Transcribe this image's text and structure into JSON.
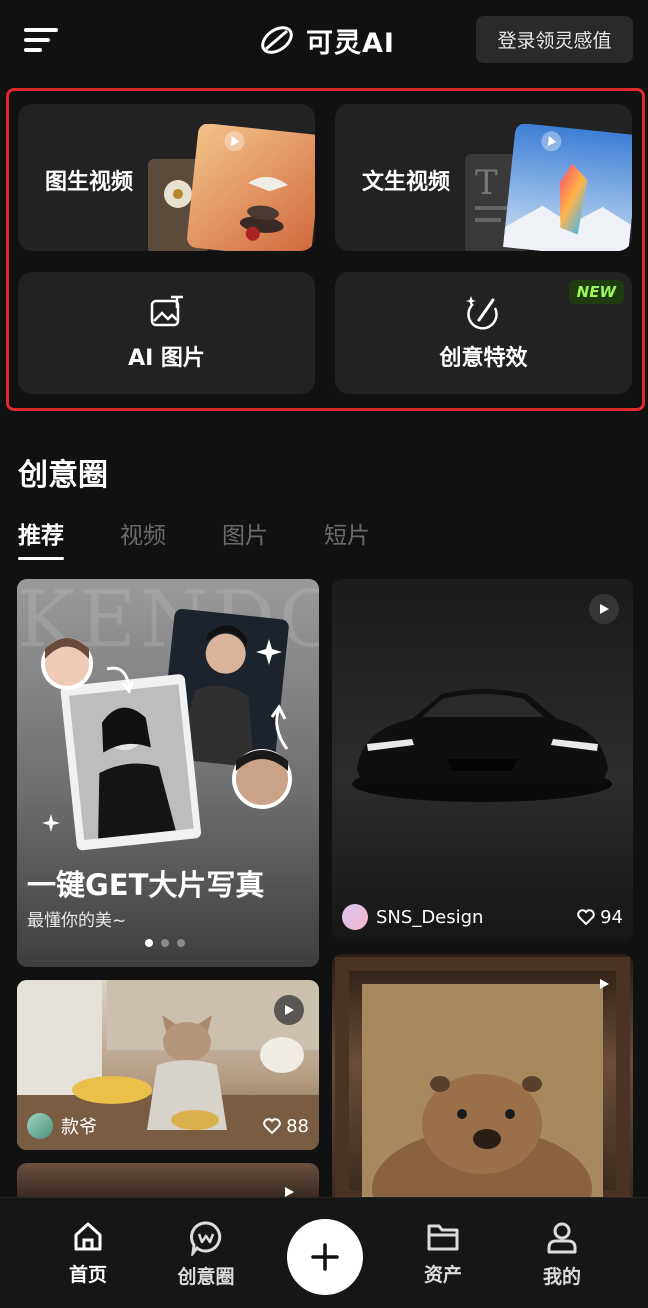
{
  "header": {
    "app_name": "可灵AI",
    "login_label": "登录领灵感值",
    "menu_icon": "menu-icon",
    "logo_icon": "kling-logo-icon"
  },
  "features": [
    {
      "label": "图生视频",
      "icon": "image-to-video-thumbnail"
    },
    {
      "label": "文生视频",
      "icon": "text-to-video-thumbnail"
    },
    {
      "label": "AI 图片",
      "icon": "image-text-icon"
    },
    {
      "label": "创意特效",
      "icon": "magic-wand-icon",
      "badge": "NEW"
    }
  ],
  "section": {
    "title": "创意圈",
    "tabs": [
      {
        "label": "推荐",
        "active": true
      },
      {
        "label": "视频",
        "active": false
      },
      {
        "label": "图片",
        "active": false
      },
      {
        "label": "短片",
        "active": false
      }
    ]
  },
  "feed": {
    "banner": {
      "title": "一键GET大片写真",
      "subtitle": "最懂你的美~",
      "bg_text": "KENDO",
      "page_count": 3,
      "active_page": 1
    },
    "posts": [
      {
        "author": "SNS_Design",
        "likes": "94",
        "kind": "video"
      },
      {
        "author": "款爷",
        "likes": "88",
        "kind": "video"
      },
      {
        "kind": "video"
      },
      {
        "kind": "video"
      }
    ]
  },
  "nav": {
    "items": [
      {
        "label": "首页",
        "icon": "home-icon",
        "active": true
      },
      {
        "label": "创意圈",
        "icon": "community-icon",
        "active": false
      },
      {
        "label": "资产",
        "icon": "folder-icon",
        "active": false
      },
      {
        "label": "我的",
        "icon": "user-icon",
        "active": false
      }
    ],
    "create_icon": "plus-icon"
  },
  "colors": {
    "background": "#111111",
    "card": "#222222",
    "highlight_frame": "#e2282a",
    "new_badge_text": "#9cf55c"
  }
}
